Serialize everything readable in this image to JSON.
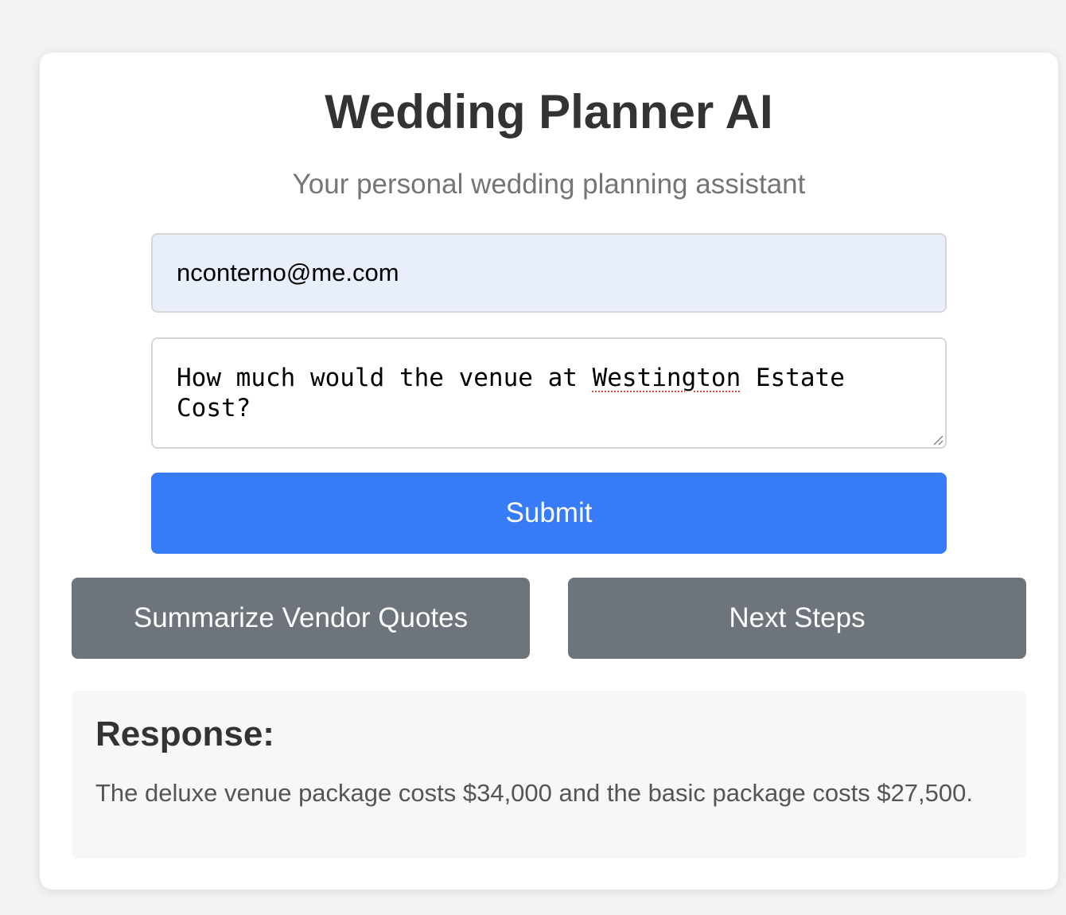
{
  "app": {
    "title": "Wedding Planner AI",
    "subtitle": "Your personal wedding planning assistant"
  },
  "form": {
    "email_value": "nconterno@me.com",
    "query_value_before": "How much would the venue at ",
    "query_value_misspelled": "Westington",
    "query_value_after": " Estate Cost?",
    "submit_label": "Submit"
  },
  "actions": {
    "summarize_label": "Summarize Vendor Quotes",
    "next_steps_label": "Next Steps"
  },
  "response": {
    "heading": "Response:",
    "text": "The deluxe venue package costs $34,000 and the basic package costs $27,500."
  },
  "colors": {
    "primary_button": "#377bf6",
    "secondary_button": "#6e747c",
    "email_background": "#e8effb",
    "response_background": "#f6f7f9"
  }
}
